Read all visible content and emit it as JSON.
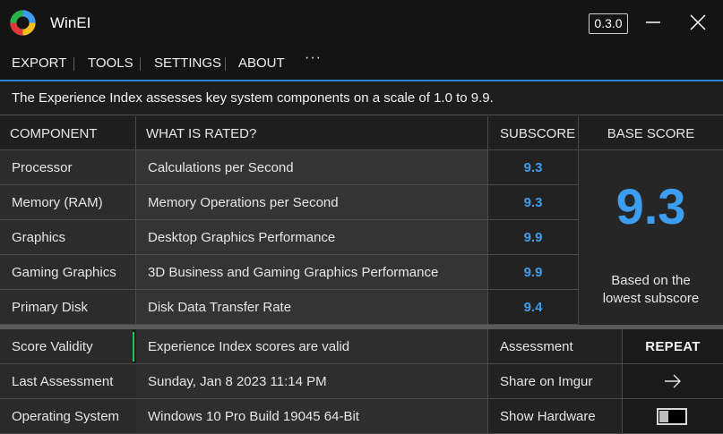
{
  "app": {
    "title": "WinEI",
    "version": "0.3.0"
  },
  "menu": {
    "items": [
      "EXPORT",
      "TOOLS",
      "SETTINGS",
      "ABOUT"
    ],
    "more": "···"
  },
  "description": "The Experience Index assesses key system components on a scale of 1.0 to 9.9.",
  "table": {
    "headers": {
      "component": "COMPONENT",
      "what": "WHAT IS RATED?",
      "subscore": "SUBSCORE",
      "base": "BASE SCORE"
    },
    "rows": [
      {
        "component": "Processor",
        "what": "Calculations per Second",
        "subscore": "9.3"
      },
      {
        "component": "Memory (RAM)",
        "what": "Memory Operations per Second",
        "subscore": "9.3"
      },
      {
        "component": "Graphics",
        "what": "Desktop Graphics Performance",
        "subscore": "9.9"
      },
      {
        "component": "Gaming Graphics",
        "what": "3D Business and Gaming Graphics Performance",
        "subscore": "9.9"
      },
      {
        "component": "Primary Disk",
        "what": "Disk Data Transfer Rate",
        "subscore": "9.4"
      }
    ],
    "base_score": "9.3",
    "base_note_1": "Based on the",
    "base_note_2": "lowest subscore"
  },
  "info": {
    "validity": {
      "label": "Score Validity",
      "value": "Experience Index scores are valid",
      "action": "Assessment",
      "control": "REPEAT"
    },
    "last": {
      "label": "Last Assessment",
      "value": "Sunday, Jan 8 2023 11:14 PM",
      "action": "Share on Imgur",
      "control": "arrow-right-icon"
    },
    "os": {
      "label": "Operating System",
      "value": "Windows 10 Pro Build 19045 64-Bit",
      "action": "Show Hardware",
      "control": "toggle"
    }
  },
  "colors": {
    "accent": "#2f86d6",
    "score": "#3d9df0",
    "valid": "#22c35a"
  }
}
